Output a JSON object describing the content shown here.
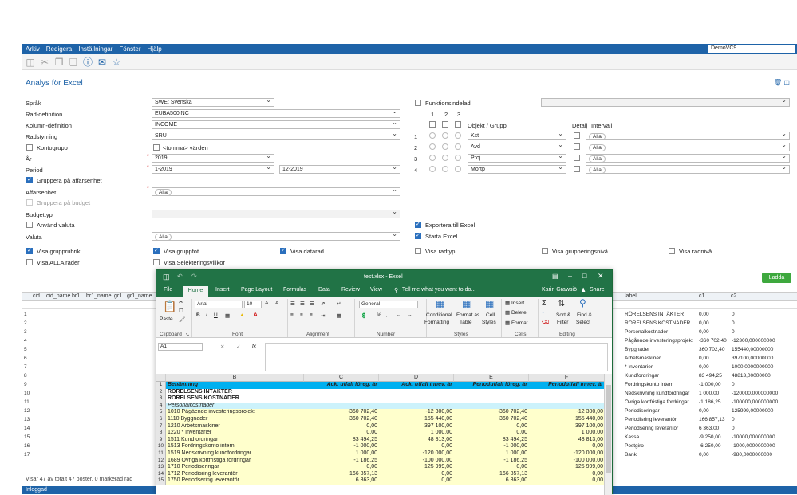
{
  "menu": [
    "Arkiv",
    "Redigera",
    "Inställningar",
    "Fönster",
    "Hjälp"
  ],
  "user_select": "DemoVC9",
  "page_title": "Analys för Excel",
  "form": {
    "sprak_label": "Språk",
    "sprak_value": "SWE; Svenska",
    "rad_label": "Rad-definition",
    "rad_value": "EUBA500INC",
    "kolumn_label": "Kolumn-definition",
    "kolumn_value": "INCOME",
    "radstyrning_label": "Radstyrning",
    "radstyrning_value": "SRU",
    "kontogrupp_label": "Kontogrupp",
    "tomma_label": "<tomma> värden",
    "ar_label": "År",
    "ar_value": "2019",
    "period_label": "Period",
    "period_from": "1-2019",
    "period_to": "12-2019",
    "gruppera_label": "Gruppera på affärsenhet",
    "affarsenhet_label": "Affärsenhet",
    "alla": "Alla",
    "gruppera_budget_label": "Gruppera på budget",
    "budgettyp_label": "Budgettyp",
    "anvand_valuta_label": "Använd valuta",
    "valuta_label": "Valuta",
    "funktionsindelad_label": "Funktionsindelad",
    "col_numbers": [
      "1",
      "2",
      "3"
    ],
    "objekt_label": "Objekt / Grupp",
    "detalj_label": "Detalj",
    "intervall_label": "Intervall",
    "objekt_rows": [
      {
        "n": "1",
        "value": "Kst"
      },
      {
        "n": "2",
        "value": "Avd"
      },
      {
        "n": "3",
        "value": "Proj"
      },
      {
        "n": "4",
        "value": "Mortp"
      }
    ],
    "exportera_label": "Exportera till Excel",
    "starta_label": "Starta Excel",
    "visa_grupprubrik": "Visa grupprubrik",
    "visa_gruppfot": "Visa gruppfot",
    "visa_datarad": "Visa datarad",
    "visa_radtyp": "Visa radtyp",
    "visa_grupperingsniva": "Visa grupperingsnivå",
    "visa_radniva": "Visa radnivå",
    "visa_alla_rader": "Visa ALLA rader",
    "visa_selektering": "Visa Selekteringsvillkor",
    "ladda": "Ladda"
  },
  "grid": {
    "headers_left": [
      "cid",
      "cid_name",
      "br1",
      "br1_name",
      "gr1",
      "gr1_name"
    ],
    "headers_right": [
      "label",
      "c1",
      "c2"
    ],
    "rows": [
      {
        "n": "1",
        "label": "RÖRELSENS INTÄKTER",
        "c1": "0,00",
        "c2": "0"
      },
      {
        "n": "2",
        "label": "RÖRELSENS KOSTNADER",
        "c1": "0,00",
        "c2": "0"
      },
      {
        "n": "3",
        "label": "Personalkostnader",
        "c1": "0,00",
        "c2": "0"
      },
      {
        "n": "4",
        "label": "Pågående investeringsprojekt",
        "c1": "-360 702,40",
        "c2": "-12300,000000000"
      },
      {
        "n": "5",
        "label": "Byggnader",
        "c1": "360 702,40",
        "c2": "155440,00000000"
      },
      {
        "n": "6",
        "label": "Arbetsmaskiner",
        "c1": "0,00",
        "c2": "397100,00000000"
      },
      {
        "n": "7",
        "label": "* Inventarier",
        "c1": "0,00",
        "c2": "1000,0000000000"
      },
      {
        "n": "8",
        "label": "Kundfordringar",
        "c1": "83 494,25",
        "c2": "48813,00000000"
      },
      {
        "n": "9",
        "label": "Fordringskonto intern",
        "c1": "-1 000,00",
        "c2": "0"
      },
      {
        "n": "10",
        "label": "Nedskrivning kundfordringar",
        "c1": "1 000,00",
        "c2": "-120000,000000000"
      },
      {
        "n": "11",
        "label": "Övriga kortfristiga fordringar",
        "c1": "-1 186,25",
        "c2": "-100000,000000000"
      },
      {
        "n": "12",
        "label": "Periodiseringar",
        "c1": "0,00",
        "c2": "125999,00000000"
      },
      {
        "n": "13",
        "label": "Periodisring leverantör",
        "c1": "166 857,13",
        "c2": "0"
      },
      {
        "n": "14",
        "label": "Periodsering leverantör",
        "c1": "6 363,00",
        "c2": "0"
      },
      {
        "n": "15",
        "label": "Kassa",
        "c1": "-9 250,00",
        "c2": "-10000,000000000"
      },
      {
        "n": "16",
        "label": "Postgiro",
        "c1": "-6 250,00",
        "c2": "-1000,0000000000"
      },
      {
        "n": "17",
        "label": "Bank",
        "c1": "0,00",
        "c2": "-980,0000000000"
      }
    ],
    "status": "Visar 47 av totalt 47 poster. 0 markerad rad"
  },
  "statusbar": "Inloggad",
  "excel": {
    "title": "test.xlsx - Excel",
    "tabs": [
      "File",
      "Home",
      "Insert",
      "Page Layout",
      "Formulas",
      "Data",
      "Review",
      "View"
    ],
    "tell_me": "Tell me what you want to do...",
    "user": "Karin Grawsiö",
    "share": "Share",
    "font_name": "Arial",
    "font_size": "10",
    "number_format": "General",
    "groups": [
      "Clipboard",
      "Font",
      "Alignment",
      "Number",
      "Styles",
      "Cells",
      "Editing"
    ],
    "buttons": {
      "paste": "Paste",
      "conditional": "Conditional",
      "formatting": "Formatting",
      "format_as": "Format as",
      "table": "Table",
      "cell": "Cell",
      "styles": "Styles",
      "insert": "Insert",
      "delete": "Delete",
      "format": "Format",
      "sort": "Sort &",
      "filter": "Filter",
      "find": "Find &",
      "select": "Select"
    },
    "name_box": "A1",
    "columns": [
      "B",
      "C",
      "D",
      "E",
      "F"
    ],
    "header_row": {
      "n": "1",
      "b": "Benämning",
      "c": "Ack. utfall föreg. år",
      "d": "Ack. utfall innev. år",
      "e": "Periodutfall föreg. år",
      "f": "Periodutfall innev. år"
    },
    "rows": [
      {
        "n": "2",
        "b": "RÖRELSENS INTÄKTER",
        "c": "",
        "d": "",
        "e": "",
        "f": "",
        "style": "bold"
      },
      {
        "n": "3",
        "b": "RÖRELSENS KOSTNADER",
        "c": "",
        "d": "",
        "e": "",
        "f": "",
        "style": "bold"
      },
      {
        "n": "4",
        "b": "Personalkostnader",
        "c": "",
        "d": "",
        "e": "",
        "f": "",
        "style": "italic"
      },
      {
        "n": "5",
        "b": "1010 Pågående investeringsprojekt",
        "c": "-360 702,40",
        "d": "-12 300,00",
        "e": "-360 702,40",
        "f": "-12 300,00",
        "style": "data"
      },
      {
        "n": "6",
        "b": "1110 Byggnader",
        "c": "360 702,40",
        "d": "155 440,00",
        "e": "360 702,40",
        "f": "155 440,00",
        "style": "data"
      },
      {
        "n": "7",
        "b": "1210 Arbetsmaskiner",
        "c": "0,00",
        "d": "397 100,00",
        "e": "0,00",
        "f": "397 100,00",
        "style": "data"
      },
      {
        "n": "8",
        "b": "1220 * Inventarier",
        "c": "0,00",
        "d": "1 000,00",
        "e": "0,00",
        "f": "1 000,00",
        "style": "data"
      },
      {
        "n": "9",
        "b": "1511 Kundfordringar",
        "c": "83 494,25",
        "d": "48 813,00",
        "e": "83 494,25",
        "f": "48 813,00",
        "style": "data"
      },
      {
        "n": "10",
        "b": "1513 Fordringskonto intern",
        "c": "-1 000,00",
        "d": "0,00",
        "e": "-1 000,00",
        "f": "0,00",
        "style": "data"
      },
      {
        "n": "11",
        "b": "1519 Nedskrivning kundfordringar",
        "c": "1 000,00",
        "d": "-120 000,00",
        "e": "1 000,00",
        "f": "-120 000,00",
        "style": "data"
      },
      {
        "n": "12",
        "b": "1689 Övriga kortfristiga fordringar",
        "c": "-1 186,25",
        "d": "-100 000,00",
        "e": "-1 186,25",
        "f": "-100 000,00",
        "style": "data"
      },
      {
        "n": "13",
        "b": "1710 Periodiseringar",
        "c": "0,00",
        "d": "125 999,00",
        "e": "0,00",
        "f": "125 999,00",
        "style": "data"
      },
      {
        "n": "14",
        "b": "1712 Periodisring leverantör",
        "c": "166 857,13",
        "d": "0,00",
        "e": "166 857,13",
        "f": "0,00",
        "style": "data"
      },
      {
        "n": "15",
        "b": "1750 Periodsering leverantör",
        "c": "6 363,00",
        "d": "0,00",
        "e": "6 363,00",
        "f": "0,00",
        "style": "data"
      }
    ]
  }
}
